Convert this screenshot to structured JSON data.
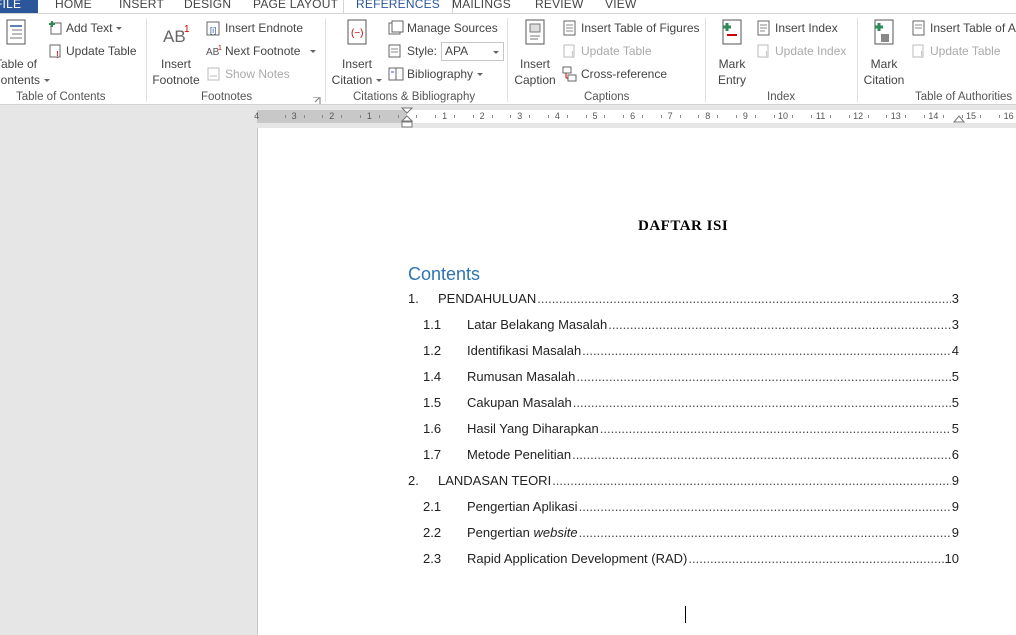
{
  "tabs": {
    "file": "FILE",
    "home": "HOME",
    "insert": "INSERT",
    "design": "DESIGN",
    "page_layout": "PAGE LAYOUT",
    "references": "REFERENCES",
    "mailings": "MAILINGS",
    "review": "REVIEW",
    "view": "VIEW"
  },
  "ribbon": {
    "toc": {
      "table_of_contents_line1": "Table of",
      "table_of_contents_line2": "Contents",
      "add_text": "Add Text",
      "update_table": "Update Table",
      "group_label": "Table of Contents"
    },
    "footnotes": {
      "insert_footnote_line1": "Insert",
      "insert_footnote_line2": "Footnote",
      "insert_endnote": "Insert Endnote",
      "next_footnote": "Next Footnote",
      "show_notes": "Show Notes",
      "group_label": "Footnotes"
    },
    "citations": {
      "insert_citation_line1": "Insert",
      "insert_citation_line2": "Citation",
      "manage_sources": "Manage Sources",
      "style_label": "Style:",
      "style_value": "APA",
      "bibliography": "Bibliography",
      "group_label": "Citations & Bibliography"
    },
    "captions": {
      "insert_caption_line1": "Insert",
      "insert_caption_line2": "Caption",
      "insert_table_of_figures": "Insert Table of Figures",
      "update_table": "Update Table",
      "cross_reference": "Cross-reference",
      "group_label": "Captions"
    },
    "index": {
      "mark_entry_line1": "Mark",
      "mark_entry_line2": "Entry",
      "insert_index": "Insert Index",
      "update_index": "Update Index",
      "group_label": "Index"
    },
    "authorities": {
      "mark_citation_line1": "Mark",
      "mark_citation_line2": "Citation",
      "insert_table_of_authorities": "Insert Table of Au",
      "update_table": "Update Table",
      "group_label": "Table of Authorities"
    }
  },
  "ruler": {
    "left_numbers": [
      "4",
      "3",
      "2",
      "1"
    ],
    "right_numbers": [
      "1",
      "2",
      "3",
      "4",
      "5",
      "6",
      "7",
      "8",
      "9",
      "10",
      "11",
      "12",
      "13",
      "14",
      "15",
      "16"
    ]
  },
  "document": {
    "title": "DAFTAR ISI",
    "toc_heading": "Contents",
    "entries": [
      {
        "num": "1.",
        "text": "PENDAHULUAN",
        "page": "3"
      },
      {
        "num": "1.1",
        "text": "Latar Belakang Masalah",
        "page": "3"
      },
      {
        "num": "1.2",
        "text": "Identifikasi Masalah",
        "page": "4"
      },
      {
        "num": "1.4",
        "text": "Rumusan Masalah",
        "page": "5"
      },
      {
        "num": "1.5",
        "text": "Cakupan Masalah",
        "page": "5"
      },
      {
        "num": "1.6",
        "text": "Hasil Yang Diharapkan",
        "page": "5"
      },
      {
        "num": "1.7",
        "text": "Metode Penelitian",
        "page": "6"
      },
      {
        "num": "2.",
        "text": "LANDASAN TEORI",
        "page": "9"
      },
      {
        "num": "2.1",
        "text": "Pengertian Aplikasi",
        "page": "9"
      },
      {
        "num": "2.2",
        "text": "Pengertian",
        "text_italic": "website",
        "page": "9"
      },
      {
        "num": "2.3",
        "text": "Rapid Application Development (RAD)",
        "page": "10"
      }
    ]
  },
  "colors": {
    "file_tab": "#2b579a",
    "active_tab": "#2b579a",
    "toc_heading": "#2e74b5"
  }
}
